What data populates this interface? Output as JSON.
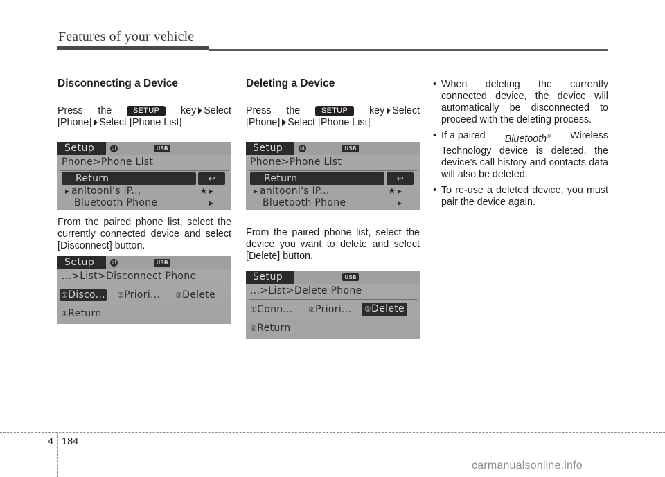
{
  "header": {
    "title": "Features of your vehicle"
  },
  "sections": {
    "disconnect": {
      "title": "Disconnecting a Device",
      "press_word": "Press",
      "the_word": "the",
      "key_label": "SETUP",
      "key_word": "key",
      "select1": "Select",
      "phone": "[Phone]",
      "select2": "Select [Phone List]",
      "instruction": "From the paired phone list, select the currently connected device and select  [Disconnect] button."
    },
    "delete": {
      "title": "Deleting a Device",
      "press_word": "Press",
      "the_word": "the",
      "key_label": "SETUP",
      "key_word": "key",
      "select1": "Select",
      "phone": "[Phone]",
      "select2": "Select [Phone List]",
      "instruction": "From the paired phone list, select the device you want to delete and select [Delete] button."
    },
    "notes": {
      "bullets": [
        "When deleting the currently connected device, the device will automatically be disconnected to proceed with the deleting process.",
        "Technology device is deleted, the device’s call history and contacts data will also be deleted.",
        "To re-use a deleted device, you must pair the device again."
      ],
      "bullet2_prefix": "If a paired",
      "bullet2_brand": "Bluetooth",
      "bullet2_reg": "®",
      "bullet2_suffix": "Wireless",
      "bullet_char": "•"
    }
  },
  "screens": {
    "phone_list": {
      "tab": "Setup",
      "bt_icon": "bt",
      "usb_icon": "USB",
      "breadcrumb": "Phone>Phone List",
      "return_label": "Return",
      "return_icon": "↩",
      "device1": "anitooni's iP...",
      "device1_star": "★",
      "device2": "Bluetooth Phone",
      "arrow": "▶"
    },
    "disconnect_phone": {
      "tab": "Setup",
      "bt_icon": "bt",
      "usb_icon": "USB",
      "breadcrumb": "...>List>Disconnect Phone",
      "options": [
        {
          "num": "①",
          "label": "Disco...",
          "selected": true
        },
        {
          "num": "②",
          "label": "Priori...",
          "selected": false
        },
        {
          "num": "③",
          "label": "Delete",
          "selected": false
        },
        {
          "num": "④",
          "label": "Return",
          "selected": false
        }
      ]
    },
    "delete_phone": {
      "tab": "Setup",
      "usb_icon": "USB",
      "breadcrumb": "...>List>Delete Phone",
      "options": [
        {
          "num": "①",
          "label": "Conn...",
          "selected": false
        },
        {
          "num": "②",
          "label": "Priori...",
          "selected": false
        },
        {
          "num": "③",
          "label": "Delete",
          "selected": true
        },
        {
          "num": "④",
          "label": "Return",
          "selected": false
        }
      ]
    }
  },
  "footer": {
    "chapter": "4",
    "page": "184",
    "watermark": "carmanualsonline.info"
  }
}
